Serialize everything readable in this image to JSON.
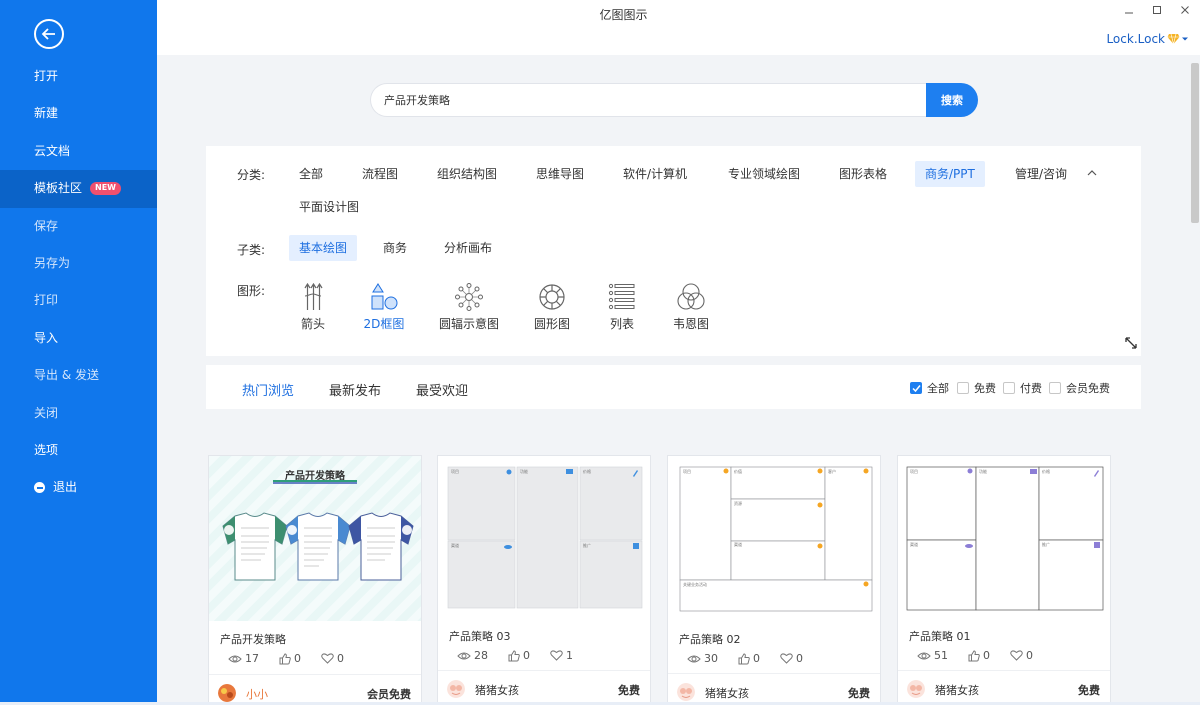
{
  "window": {
    "title": "亿图图示",
    "user": "Lock.Lock"
  },
  "sidebar": {
    "items": [
      {
        "label": "打开",
        "style": "bright"
      },
      {
        "label": "新建",
        "style": "bright"
      },
      {
        "label": "云文档",
        "style": "bright"
      },
      {
        "label": "模板社区",
        "style": "active",
        "badge": "NEW"
      },
      {
        "label": "保存",
        "style": "dim"
      },
      {
        "label": "另存为",
        "style": "dim"
      },
      {
        "label": "打印",
        "style": "dim"
      },
      {
        "label": "导入",
        "style": "bright"
      },
      {
        "label": "导出 & 发送",
        "style": "dim"
      },
      {
        "label": "关闭",
        "style": "dim"
      },
      {
        "label": "选项",
        "style": "bright"
      },
      {
        "label": "退出",
        "style": "bright"
      }
    ]
  },
  "search": {
    "value": "产品开发策略",
    "button": "搜索"
  },
  "filters": {
    "category_label": "分类:",
    "categories": [
      "全部",
      "流程图",
      "组织结构图",
      "思维导图",
      "软件/计算机",
      "专业领域绘图",
      "图形表格",
      "商务/PPT",
      "管理/咨询",
      "平面设计图"
    ],
    "category_selected": "商务/PPT",
    "subcategory_label": "子类:",
    "subcategories": [
      "基本绘图",
      "商务",
      "分析画布"
    ],
    "subcategory_selected": "基本绘图",
    "shape_label": "图形:",
    "shapes": [
      "箭头",
      "2D框图",
      "圆辐示意图",
      "圆形图",
      "列表",
      "韦恩图"
    ],
    "shape_selected": "2D框图"
  },
  "sort": {
    "tabs": [
      "热门浏览",
      "最新发布",
      "最受欢迎"
    ],
    "active": "热门浏览",
    "price_filters": [
      {
        "label": "全部",
        "checked": true
      },
      {
        "label": "免费",
        "checked": false
      },
      {
        "label": "付费",
        "checked": false
      },
      {
        "label": "会员免费",
        "checked": false
      }
    ]
  },
  "cards": [
    {
      "title": "产品开发策略",
      "views": "17",
      "likes": "0",
      "favorites": "0",
      "author": "小小",
      "price": "会员免费",
      "thumb_heading": "产品开发策略"
    },
    {
      "title": "产品策略 03",
      "views": "28",
      "likes": "0",
      "favorites": "1",
      "author": "猪猪女孩",
      "price": "免费"
    },
    {
      "title": "产品策略 02",
      "views": "30",
      "likes": "0",
      "favorites": "0",
      "author": "猪猪女孩",
      "price": "免费"
    },
    {
      "title": "产品策略 01",
      "views": "51",
      "likes": "0",
      "favorites": "0",
      "author": "猪猪女孩",
      "price": "免费"
    }
  ],
  "colors": {
    "sidebar": "#1077ec",
    "accent": "#1e7ff0",
    "selected_bg": "#e4efff",
    "badge": "#f0506e"
  }
}
